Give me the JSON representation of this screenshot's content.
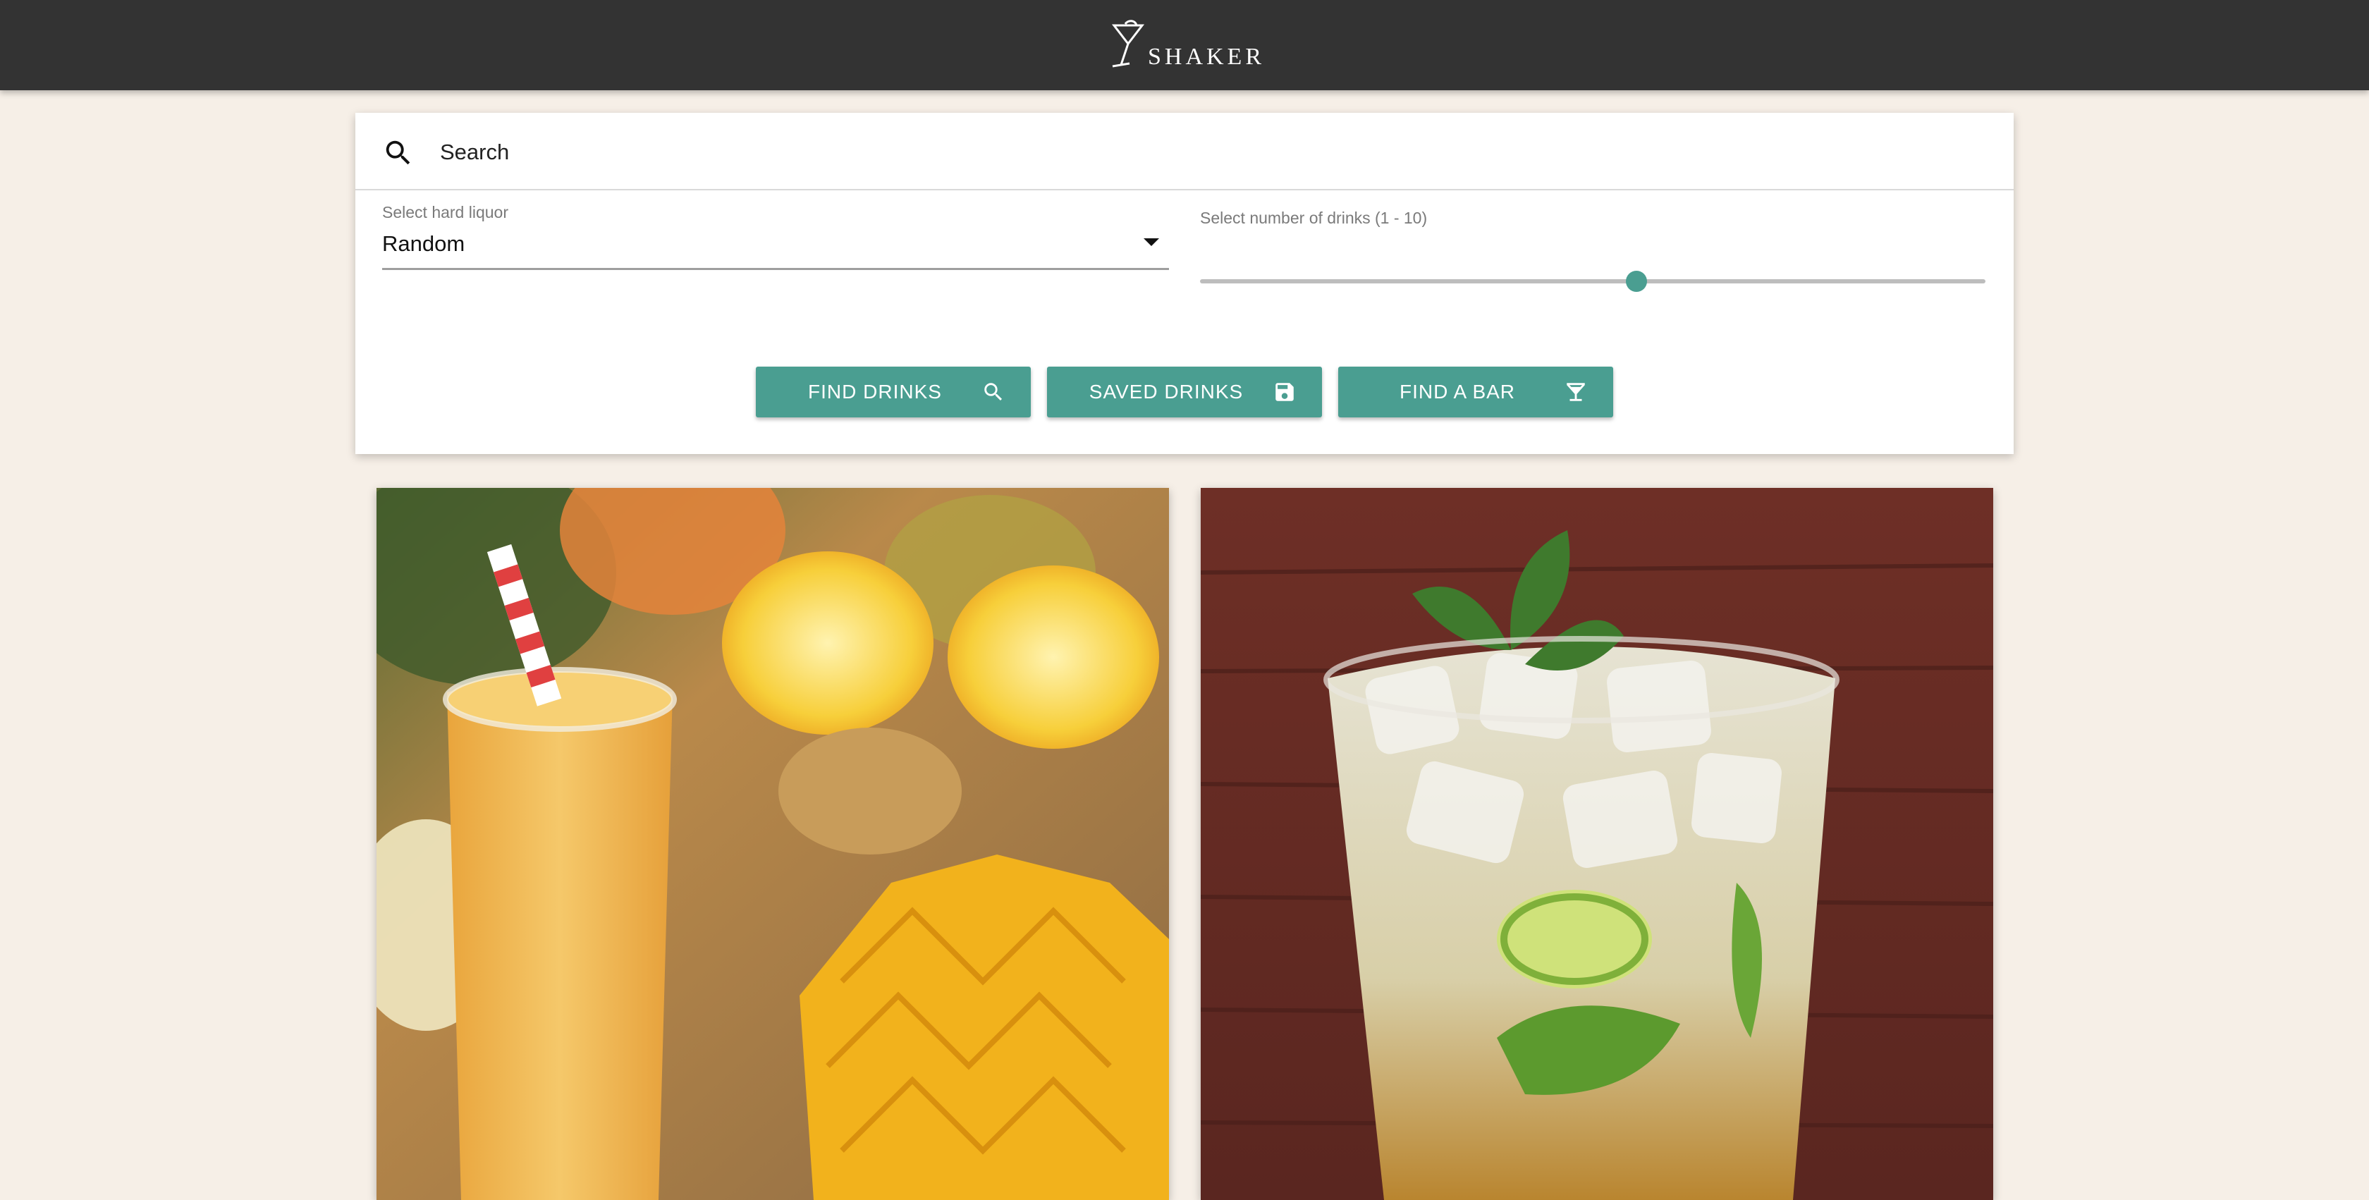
{
  "header": {
    "logo_text": "SHAKER",
    "logo_icon": "martini-glass-icon",
    "background": "#333333"
  },
  "search": {
    "icon": "search-icon",
    "placeholder": "Search",
    "value": ""
  },
  "liquor_select": {
    "label": "Select hard liquor",
    "selected": "Random",
    "icon": "caret-down-icon"
  },
  "drinks_slider": {
    "label": "Select number of drinks (1 - 10)",
    "min": 1,
    "max": 10,
    "value": 6,
    "accent": "#4a9e91"
  },
  "actions": {
    "find_drinks": {
      "label": "FIND DRINKS",
      "icon": "search-icon"
    },
    "saved_drinks": {
      "label": "SAVED DRINKS",
      "icon": "save-icon"
    },
    "find_bar": {
      "label": "FIND A BAR",
      "icon": "cocktail-glass-icon"
    },
    "button_color": "#4a9e91"
  },
  "cards": [
    {
      "image": "mango-smoothie-drink-photo"
    },
    {
      "image": "mojito-cocktail-drink-photo"
    }
  ],
  "page_background": "#f6efe7"
}
